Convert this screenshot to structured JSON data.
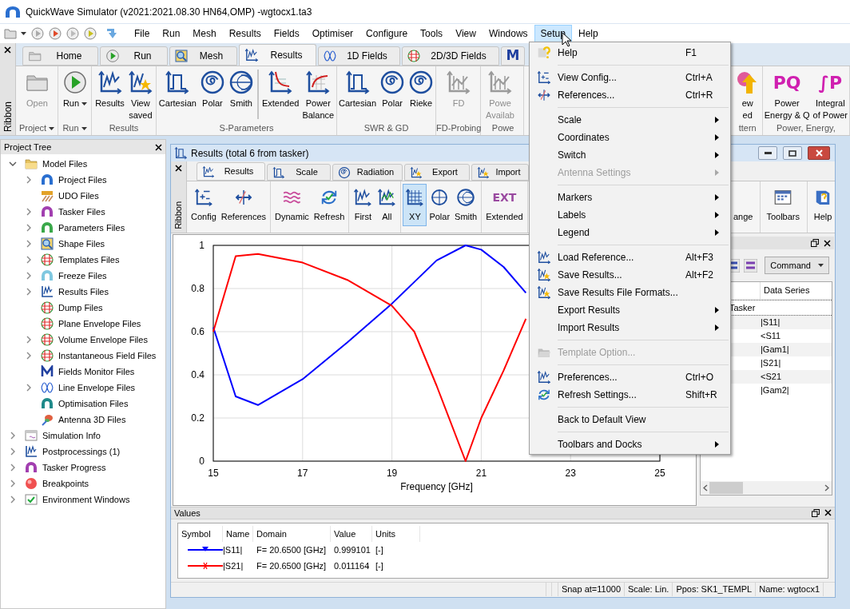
{
  "window": {
    "title": "QuickWave Simulator (v2021:2021.08.30 HN64,OMP) -wgtocx1.ta3"
  },
  "menu_bar": [
    {
      "label": "File",
      "selected": false
    },
    {
      "label": "Run",
      "selected": false
    },
    {
      "label": "Mesh",
      "selected": false
    },
    {
      "label": "Results",
      "selected": false
    },
    {
      "label": "Fields",
      "selected": false
    },
    {
      "label": "Optimiser",
      "selected": false
    },
    {
      "label": "Configure",
      "selected": false
    },
    {
      "label": "Tools",
      "selected": false
    },
    {
      "label": "View",
      "selected": false
    },
    {
      "label": "Windows",
      "selected": false
    },
    {
      "label": "Setup",
      "selected": true
    },
    {
      "label": "Help",
      "selected": false
    }
  ],
  "ribbon": {
    "side_label": "Ribbon",
    "tabs": [
      {
        "label": "Home",
        "selected": false
      },
      {
        "label": "Run",
        "selected": false
      },
      {
        "label": "Mesh",
        "selected": false
      },
      {
        "label": "Results",
        "selected": true
      },
      {
        "label": "1D Fields",
        "selected": false
      },
      {
        "label": "2D/3D Fields",
        "selected": false
      },
      {
        "icon_text": "M",
        "selected": false
      }
    ],
    "groups": [
      {
        "label": "Project",
        "dropdown": true,
        "buttons": [
          {
            "label": "Open",
            "disabled": true
          }
        ]
      },
      {
        "label": "Run",
        "dropdown": true,
        "buttons": [
          {
            "label": "Run",
            "dropdown": true,
            "disabled": false
          }
        ]
      },
      {
        "label": "Results",
        "buttons": [
          {
            "label": "Results",
            "disabled": false
          },
          {
            "label": "View\nsaved",
            "disabled": false
          }
        ]
      },
      {
        "label": "S-Parameters",
        "buttons": [
          {
            "label": "Cartesian",
            "disabled": false
          },
          {
            "label": "Polar",
            "disabled": false
          },
          {
            "label": "Smith",
            "disabled": false
          },
          {
            "label": "Extended",
            "divider_before": true,
            "disabled": false
          },
          {
            "label": "Power\nBalance",
            "disabled": false
          }
        ]
      },
      {
        "label": "SWR & GD",
        "buttons": [
          {
            "label": "Cartesian",
            "disabled": false
          },
          {
            "label": "Polar",
            "disabled": false
          },
          {
            "label": "Rieke",
            "disabled": false
          }
        ]
      },
      {
        "label": "FD-Probing",
        "buttons": [
          {
            "label": "FD",
            "disabled": true
          }
        ]
      },
      {
        "label": "Powe",
        "buttons": [
          {
            "label": "Powe\nAvailab",
            "disabled": true
          }
        ]
      }
    ],
    "right_groups": [
      {
        "label": "ttern",
        "buttons": [
          {
            "label": "ew\ned",
            "disabled": false
          }
        ]
      },
      {
        "label": "Power, Energy,",
        "buttons": [
          {
            "label": "Power\nEnergy & Q",
            "icon_text": "PQ",
            "disabled": false
          },
          {
            "label": "Integral\nof Power",
            "icon_text": "∫P",
            "disabled": false
          }
        ]
      }
    ]
  },
  "project_tree": {
    "title": "Project Tree",
    "items": [
      {
        "label": "Model Files",
        "kind": "folder",
        "expanded": true,
        "children": [
          {
            "label": "Project Files",
            "kind": "folder",
            "expanded": false
          },
          {
            "label": "UDO Files",
            "kind": "leaf"
          },
          {
            "label": "Tasker Files",
            "kind": "folder",
            "expanded": false
          },
          {
            "label": "Parameters Files",
            "kind": "folder",
            "expanded": false
          },
          {
            "label": "Shape Files",
            "kind": "folder",
            "expanded": false
          },
          {
            "label": "Templates Files",
            "kind": "folder",
            "expanded": false
          },
          {
            "label": "Freeze Files",
            "kind": "folder",
            "expanded": false
          },
          {
            "label": "Results Files",
            "kind": "folder",
            "expanded": false
          },
          {
            "label": "Dump Files",
            "kind": "leaf"
          },
          {
            "label": "Plane Envelope Files",
            "kind": "leaf"
          },
          {
            "label": "Volume Envelope Files",
            "kind": "folder",
            "expanded": false
          },
          {
            "label": "Instantaneous Field Files",
            "kind": "folder",
            "expanded": false
          },
          {
            "label": "Fields Monitor Files",
            "kind": "leaf"
          },
          {
            "label": "Line Envelope Files",
            "kind": "folder",
            "expanded": false
          },
          {
            "label": "Optimisation Files",
            "kind": "leaf"
          },
          {
            "label": "Antenna 3D Files",
            "kind": "leaf"
          }
        ]
      },
      {
        "label": "Simulation Info",
        "kind": "folder",
        "expanded": false
      },
      {
        "label": "Postprocessings (1)",
        "kind": "folder",
        "expanded": false
      },
      {
        "label": "Tasker Progress",
        "kind": "folder",
        "expanded": false
      },
      {
        "label": "Breakpoints",
        "kind": "folder",
        "expanded": false
      },
      {
        "label": "Environment Windows",
        "kind": "folder",
        "expanded": false
      }
    ]
  },
  "results_window": {
    "title": "Results (total 6 from tasker)",
    "ribbon": {
      "side_label": "Ribbon",
      "tabs": [
        {
          "label": "Results",
          "selected": true
        },
        {
          "label": "Scale",
          "selected": false
        },
        {
          "label": "Radiation",
          "selected": false
        },
        {
          "label": "Export",
          "selected": false
        },
        {
          "label": "Import",
          "selected": false
        }
      ],
      "groups": [
        {
          "buttons": [
            {
              "label": "Config"
            },
            {
              "label": "References"
            }
          ]
        },
        {
          "buttons": [
            {
              "label": "Dynamic"
            },
            {
              "label": "Refresh"
            }
          ]
        },
        {
          "buttons": [
            {
              "label": "First"
            },
            {
              "label": "All"
            }
          ]
        },
        {
          "buttons": [
            {
              "label": "XY",
              "selected": true
            },
            {
              "label": "Polar",
              "selected": false
            },
            {
              "label": "Smith",
              "selected": false
            }
          ]
        },
        {
          "buttons": [
            {
              "label": "Extended",
              "icon_text": "EXT"
            }
          ]
        }
      ],
      "right_groups": [
        {
          "buttons": [
            {
              "label": "ange"
            }
          ]
        },
        {
          "buttons": [
            {
              "label": "Toolbars"
            }
          ]
        },
        {
          "buttons": [
            {
              "label": "Help"
            }
          ]
        }
      ]
    },
    "chart_data": {
      "type": "line",
      "xlabel": "Frequency [GHz]",
      "x": [
        15,
        15.5,
        16,
        17,
        18,
        19,
        19.5,
        20,
        20.65,
        21,
        21.5,
        22
      ],
      "series": [
        {
          "color": "#0000ff",
          "values": [
            0.62,
            0.3,
            0.26,
            0.38,
            0.55,
            0.73,
            0.83,
            0.93,
            1.0,
            0.98,
            0.9,
            0.78
          ]
        },
        {
          "color": "#ff0000",
          "values": [
            0.6,
            0.95,
            0.96,
            0.92,
            0.84,
            0.72,
            0.6,
            0.35,
            0.0,
            0.2,
            0.42,
            0.66
          ]
        }
      ],
      "xlim": [
        15,
        25
      ],
      "ylim": [
        0,
        1
      ],
      "xticks": [
        15,
        17,
        19,
        21,
        23,
        25
      ],
      "yticks": [
        0,
        0.2,
        0.4,
        0.6,
        0.8,
        1
      ],
      "grid": true
    },
    "series_panel": {
      "command": "Command",
      "column": "Data Series",
      "group": "Tasker",
      "rows": [
        "|S11|",
        "<S11",
        "|Gam1|",
        "|S21|",
        "<S21",
        "|Gam2|"
      ]
    },
    "values": {
      "title": "Values",
      "columns": [
        "Symbol",
        "Name",
        "Domain",
        "Value",
        "Units"
      ],
      "rows": [
        {
          "color": "#0000ff",
          "kind": "triangle",
          "name": "|S11|",
          "domain": "F= 20.6500 [GHz]",
          "value": "0.999101",
          "units": "[-]"
        },
        {
          "color": "#ff0000",
          "kind": "cross",
          "name": "|S21|",
          "domain": "F= 20.6500 [GHz]",
          "value": "0.011164",
          "units": "[-]"
        }
      ]
    },
    "status_bar": [
      "Snap at=11000",
      "Scale: Lin.",
      "Ppos: SK1_TEMPL",
      "Name: wgtocx1"
    ]
  },
  "context_menu": {
    "items": [
      {
        "kind": "item",
        "label": "Help",
        "shortcut": "F1"
      },
      {
        "kind": "separator"
      },
      {
        "kind": "item",
        "label": "View Config...",
        "shortcut": "Ctrl+A"
      },
      {
        "kind": "item",
        "label": "References...",
        "shortcut": "Ctrl+R"
      },
      {
        "kind": "separator"
      },
      {
        "kind": "item",
        "label": "Scale",
        "submenu": true
      },
      {
        "kind": "item",
        "label": "Coordinates",
        "submenu": true
      },
      {
        "kind": "item",
        "label": "Switch",
        "submenu": true
      },
      {
        "kind": "item",
        "label": "Antenna Settings",
        "submenu": true,
        "disabled": true
      },
      {
        "kind": "separator"
      },
      {
        "kind": "item",
        "label": "Markers",
        "submenu": true
      },
      {
        "kind": "item",
        "label": "Labels",
        "submenu": true
      },
      {
        "kind": "item",
        "label": "Legend",
        "submenu": true
      },
      {
        "kind": "separator"
      },
      {
        "kind": "item",
        "label": "Load Reference...",
        "shortcut": "Alt+F3"
      },
      {
        "kind": "item",
        "label": "Save Results...",
        "shortcut": "Alt+F2"
      },
      {
        "kind": "item",
        "label": "Save Results File Formats..."
      },
      {
        "kind": "item",
        "label": "Export Results",
        "submenu": true
      },
      {
        "kind": "item",
        "label": "Import Results",
        "submenu": true
      },
      {
        "kind": "separator"
      },
      {
        "kind": "item",
        "label": "Template Option...",
        "disabled": true
      },
      {
        "kind": "separator"
      },
      {
        "kind": "item",
        "label": "Preferences...",
        "shortcut": "Ctrl+O"
      },
      {
        "kind": "item",
        "label": "Refresh Settings...",
        "shortcut": "Shift+R"
      },
      {
        "kind": "separator"
      },
      {
        "kind": "item",
        "label": "Back to Default View"
      },
      {
        "kind": "separator"
      },
      {
        "kind": "item",
        "label": "Toolbars and Docks",
        "submenu": true
      }
    ]
  }
}
